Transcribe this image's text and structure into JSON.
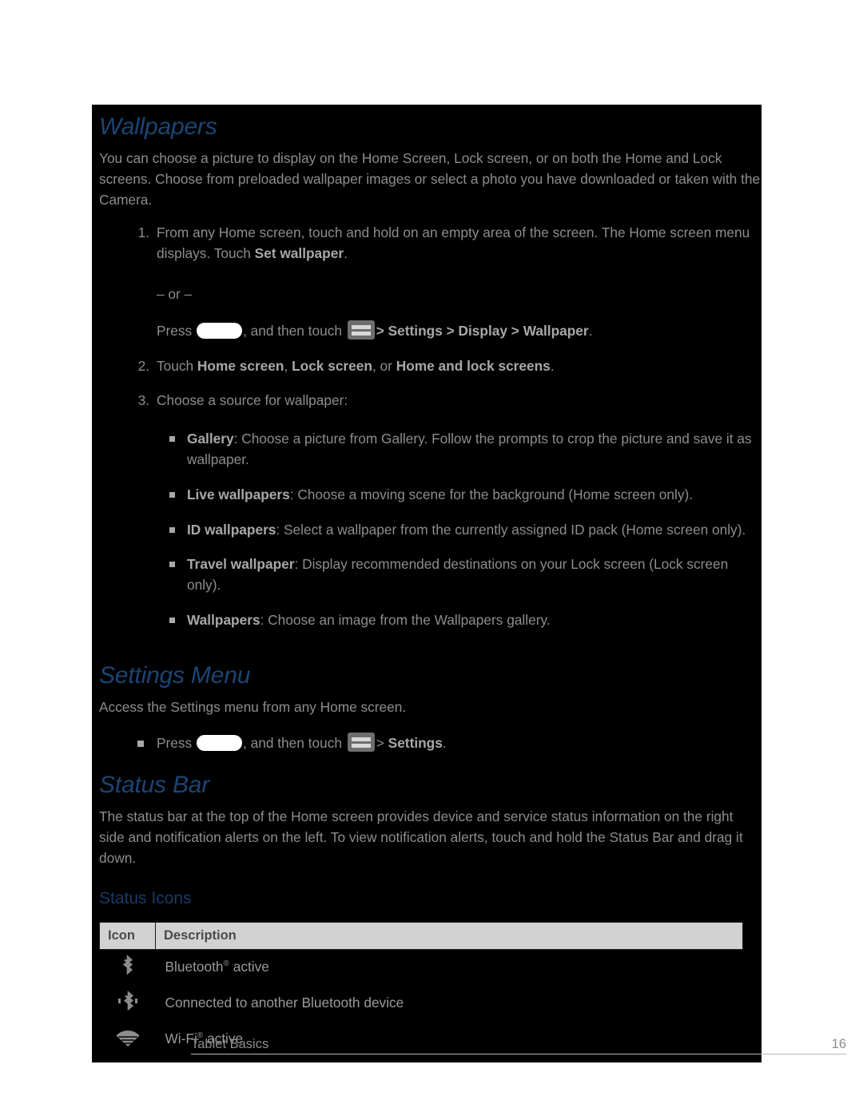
{
  "page": {
    "footer_left": "Tablet Basics",
    "footer_page_number": "16",
    "heading_color": "#1c4574",
    "body_color": "#8d8d8d",
    "background_color": "#000000"
  },
  "wallpapers": {
    "title": "Wallpapers",
    "intro": "You can choose a picture to display on the Home Screen, Lock screen, or on both the Home and Lock screens. Choose from preloaded wallpaper images or select a photo you have downloaded or taken with the Camera.",
    "steps": [
      {
        "num": "1.",
        "text_a": "From any Home screen, touch and hold on an empty area of the screen. The Home screen menu displays. Touch ",
        "bold_a": "Set wallpaper",
        "text_b": ".",
        "or_separator": "– or –",
        "press_label": "Press",
        "home_icon": "home-key-icon",
        "after_home": ", and then touch",
        "menu_icon": "menu-key-icon",
        "path": "> Settings > Display > Wallpaper",
        "path_parts": [
          "Settings",
          "Display",
          "Wallpaper"
        ],
        "trailing": "."
      },
      {
        "num": "2.",
        "prefix": "Touch ",
        "bold_1": "Home screen",
        "sep_1": ", ",
        "bold_2": "Lock screen",
        "sep_2": ", or ",
        "bold_3": "Home and lock screens",
        "trailing": "."
      },
      {
        "num": "3.",
        "text": "Choose a source for wallpaper:"
      }
    ],
    "sources": [
      {
        "term": "Gallery",
        "desc": ": Choose a picture from Gallery. Follow the prompts to crop the picture and save it as wallpaper."
      },
      {
        "term": "Live wallpapers",
        "desc": ": Choose a moving scene for the background (Home screen only)."
      },
      {
        "term": "ID wallpapers",
        "desc": ": Select a wallpaper from the currently assigned ID pack (Home screen only)."
      },
      {
        "term": "Travel wallpaper",
        "desc": ": Display recommended destinations on your Lock screen (Lock screen only)."
      },
      {
        "term": "Wallpapers",
        "desc": ": Choose an image from the Wallpapers gallery."
      }
    ]
  },
  "settings_menu": {
    "title": "Settings Menu",
    "intro": "Access the Settings menu from any Home screen.",
    "bullet": {
      "press_label": "Press",
      "home_icon": "home-key-icon",
      "after_home": ", and then touch",
      "menu_icon": "menu-key-icon",
      "arrow": ">",
      "target": "Settings",
      "trailing": "."
    }
  },
  "status_bar": {
    "title": "Status Bar",
    "intro": "The status bar at the top of the Home screen provides device and service status information on the right side and notification alerts on the left. To view notification alerts, touch and hold the Status Bar and drag it down.",
    "subheading": "Status Icons",
    "table": {
      "headers": [
        "Icon",
        "Description"
      ],
      "rows": [
        {
          "icon": "bluetooth-icon",
          "desc_pre": "Bluetooth",
          "desc_sup": "®",
          "desc_post": " active"
        },
        {
          "icon": "bluetooth-connected-icon",
          "desc_pre": "Connected to another Bluetooth device",
          "desc_sup": "",
          "desc_post": ""
        },
        {
          "icon": "wifi-icon",
          "desc_pre": "Wi-Fi",
          "desc_sup": "®",
          "desc_post": " active"
        }
      ]
    }
  }
}
